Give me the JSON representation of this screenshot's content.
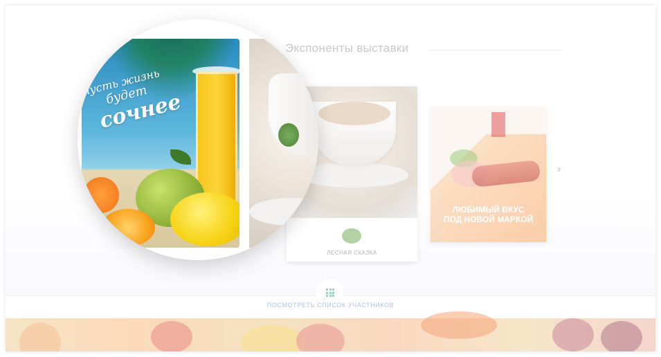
{
  "section": {
    "title": "Экспоненты выставки"
  },
  "cards": [
    {
      "label": "ЛЕСНАЯ СКАЗКА",
      "image": "coffee-cup"
    },
    {
      "headline_line1": "ЛЮБИМЫЙ ВКУС",
      "headline_line2": "ПОД НОВОЙ МАРКОЙ",
      "image": "sausage-brand"
    }
  ],
  "zoom": {
    "slogan_line1": "пусть жизнь",
    "slogan_line2": "будет",
    "slogan_line3": "сочнее"
  },
  "carousel": {
    "next_icon": "chevron-right-icon"
  },
  "footer": {
    "grid_icon": "grid-icon",
    "list_link": "ПОСМОТРЕТЬ СПИСОК УЧАСТНИКОВ"
  },
  "colors": {
    "accent_link": "#a9c5e6",
    "grid_icon": "#9dd0c0",
    "title": "#c9c9c9"
  }
}
